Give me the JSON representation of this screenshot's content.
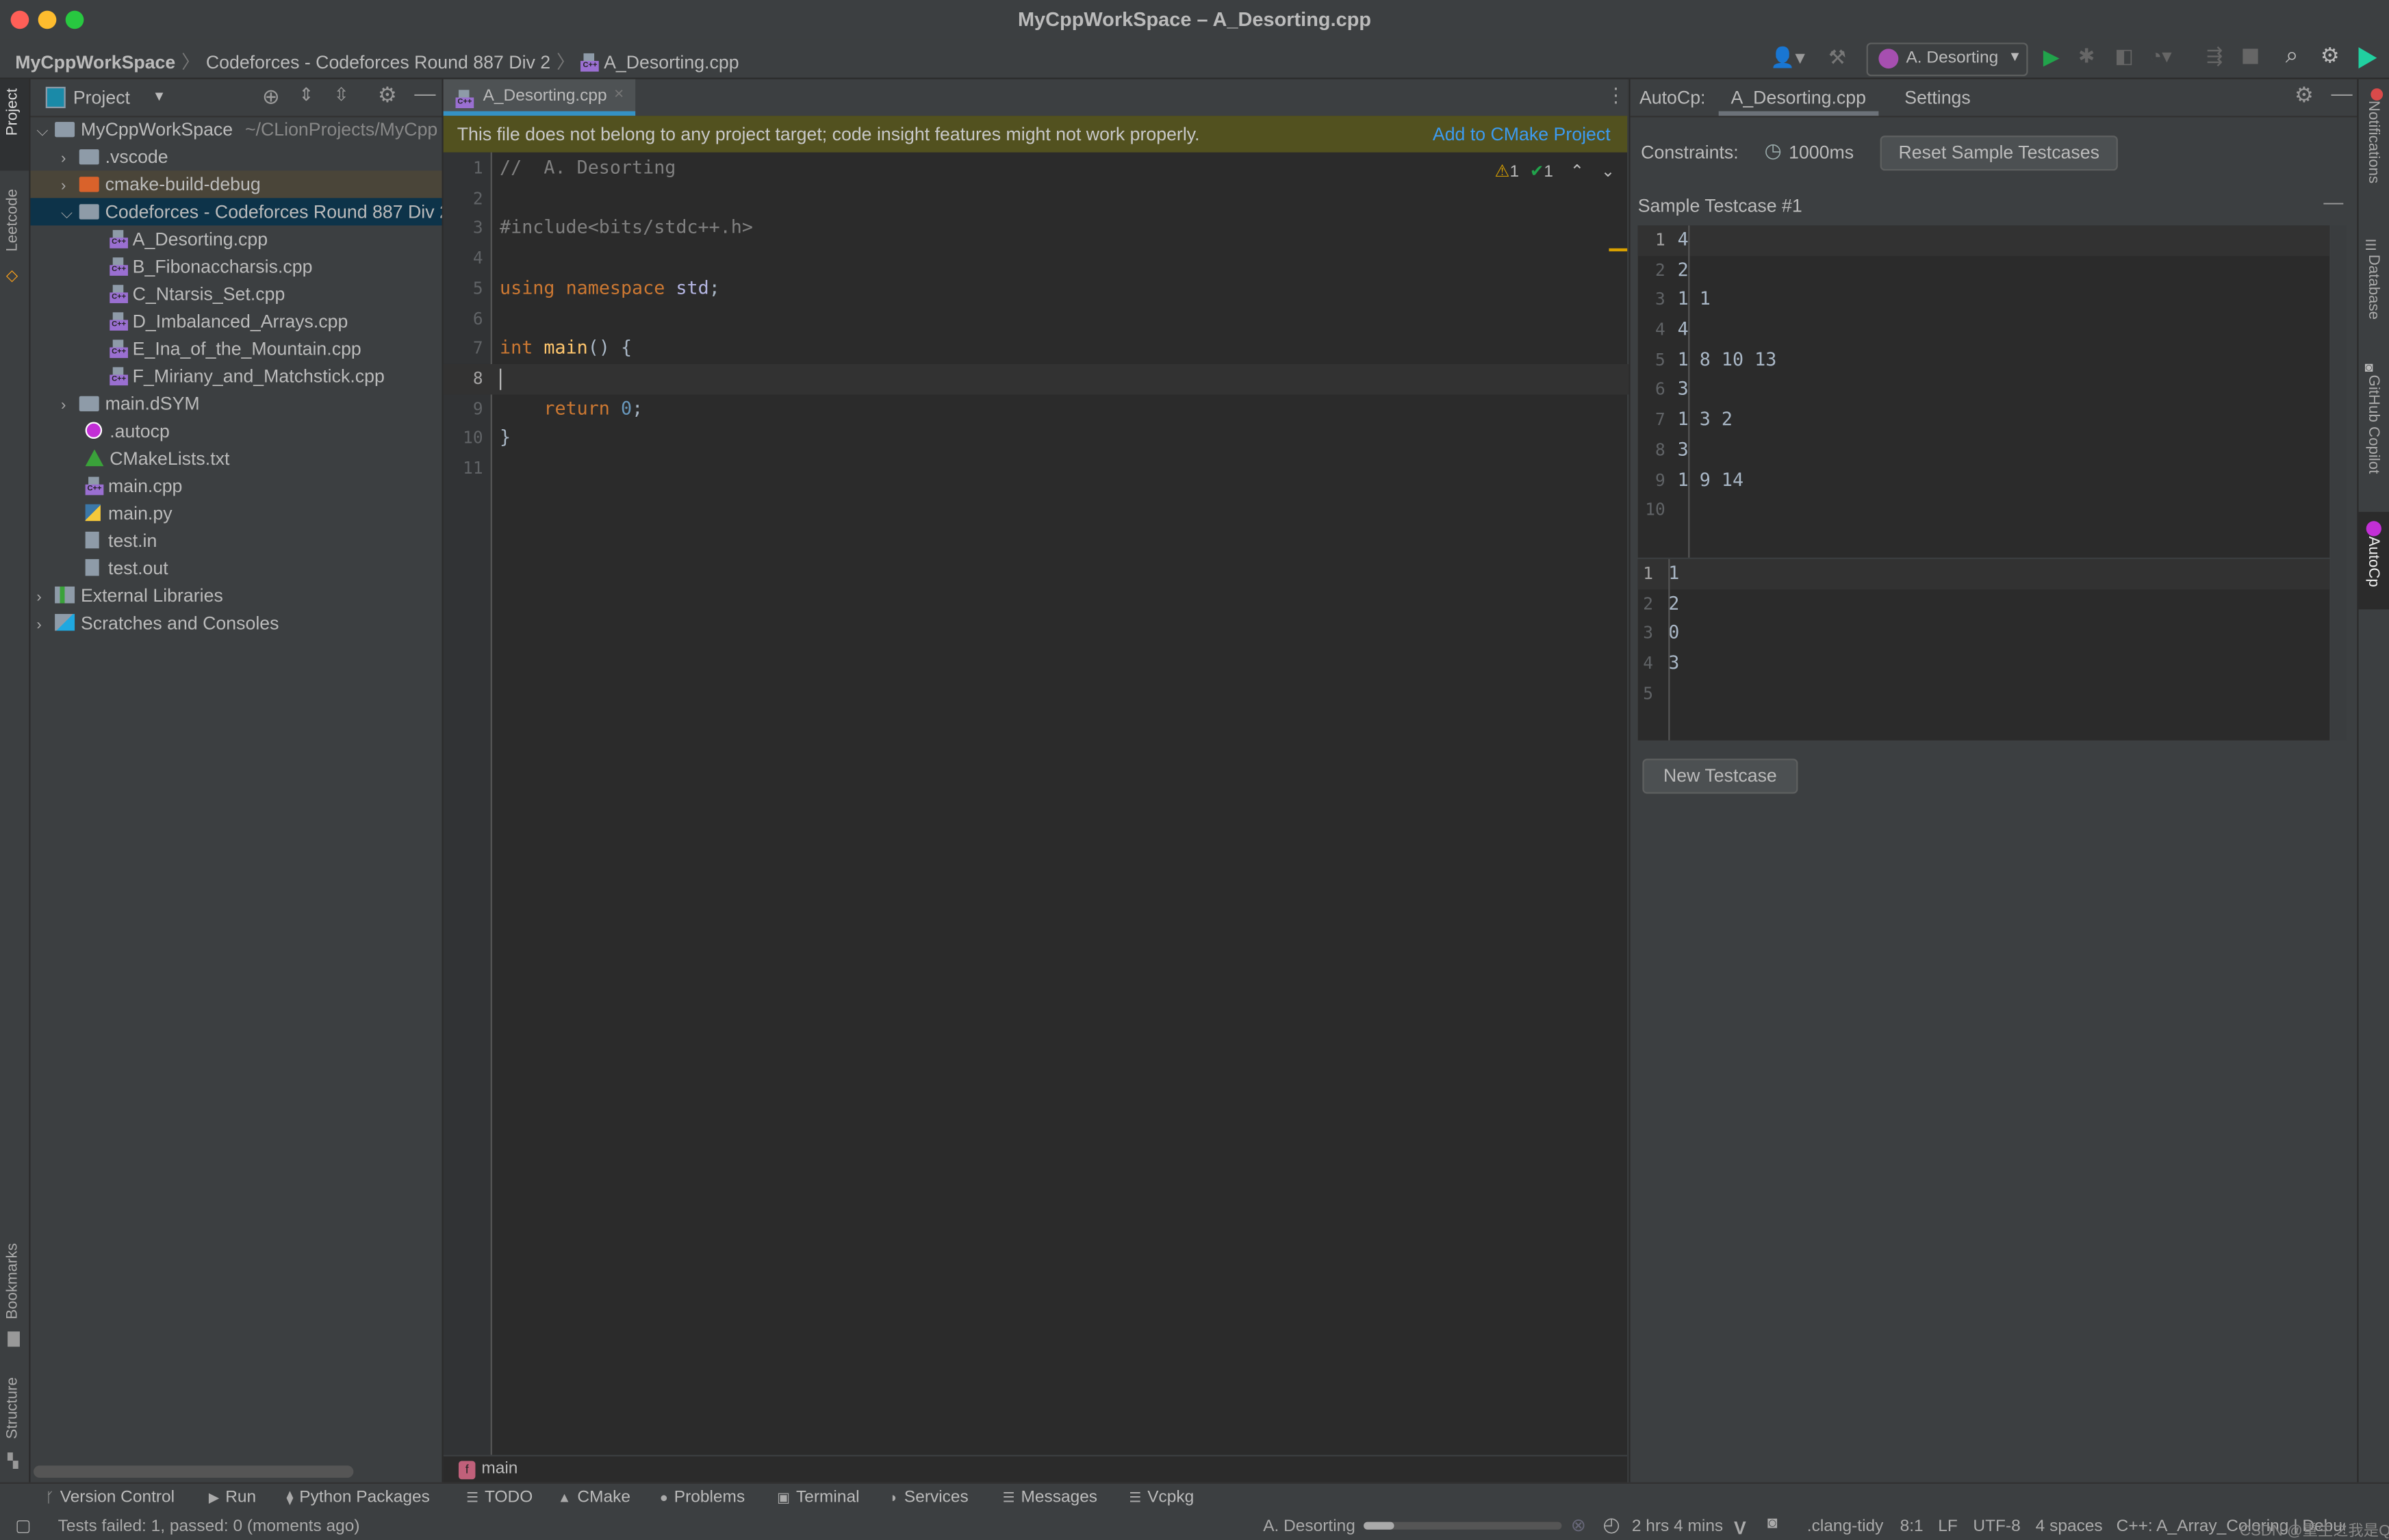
{
  "window": {
    "title": "MyCppWorkSpace – A_Desorting.cpp"
  },
  "breadcrumb": [
    "MyCppWorkSpace",
    "Codeforces - Codeforces Round 887 Div 2",
    "A_Desorting.cpp"
  ],
  "toolbar": {
    "run_config": "A. Desorting"
  },
  "left_stripe": {
    "top": [
      "Project",
      "Leetcode"
    ],
    "bottom": [
      "Bookmarks",
      "Structure"
    ]
  },
  "right_stripe": [
    "Notifications",
    "Database",
    "GitHub Copilot",
    "AutoCp"
  ],
  "project": {
    "header": "Project",
    "root": {
      "name": "MyCppWorkSpace",
      "path": "~/CLionProjects/MyCpp"
    },
    "items": [
      {
        "name": ".vscode",
        "type": "folder",
        "level": 1,
        "expanded": false
      },
      {
        "name": "cmake-build-debug",
        "type": "folder-excluded",
        "level": 1,
        "expanded": false
      },
      {
        "name": "Codeforces - Codeforces Round 887 Div 2",
        "type": "folder",
        "level": 1,
        "expanded": true,
        "selected": true
      },
      {
        "name": "A_Desorting.cpp",
        "type": "cpp",
        "level": 2
      },
      {
        "name": "B_Fibonaccharsis.cpp",
        "type": "cpp",
        "level": 2
      },
      {
        "name": "C_Ntarsis_Set.cpp",
        "type": "cpp",
        "level": 2
      },
      {
        "name": "D_Imbalanced_Arrays.cpp",
        "type": "cpp",
        "level": 2
      },
      {
        "name": "E_Ina_of_the_Mountain.cpp",
        "type": "cpp",
        "level": 2
      },
      {
        "name": "F_Miriany_and_Matchstick.cpp",
        "type": "cpp",
        "level": 2
      },
      {
        "name": "main.dSYM",
        "type": "folder",
        "level": 1,
        "expanded": false
      },
      {
        "name": ".autocp",
        "type": "autocp",
        "level": 1
      },
      {
        "name": "CMakeLists.txt",
        "type": "cmake",
        "level": 1
      },
      {
        "name": "main.cpp",
        "type": "cpp",
        "level": 1
      },
      {
        "name": "main.py",
        "type": "python",
        "level": 1
      },
      {
        "name": "test.in",
        "type": "text",
        "level": 1
      },
      {
        "name": "test.out",
        "type": "text",
        "level": 1
      }
    ],
    "external": "External Libraries",
    "scratches": "Scratches and Consoles"
  },
  "editor": {
    "tab": "A_Desorting.cpp",
    "banner": {
      "message": "This file does not belong to any project target; code insight features might not work properly.",
      "action": "Add to CMake Project"
    },
    "inspections": {
      "warnings": "1",
      "typos": "1"
    },
    "current_line": "8",
    "breadcrumb_fn": "main",
    "lines": [
      "//  A. Desorting",
      "",
      "#include<bits/stdc++.h>",
      "",
      "using namespace std;",
      "",
      "int main() {",
      "",
      "    return 0;",
      "}",
      ""
    ]
  },
  "autocp": {
    "label": "AutoCp:",
    "tabs": [
      "A_Desorting.cpp",
      "Settings"
    ],
    "constraints_label": "Constraints:",
    "time_limit": "1000ms",
    "reset_button": "Reset Sample Testcases",
    "testcase_title": "Sample Testcase #1",
    "input": [
      "4",
      "2",
      "1 1",
      "4",
      "1 8 10 13",
      "3",
      "1 3 2",
      "3",
      "1 9 14",
      ""
    ],
    "output": [
      "1",
      "2",
      "0",
      "3",
      ""
    ],
    "new_button": "New Testcase"
  },
  "tool_windows": [
    "Version Control",
    "Run",
    "Python Packages",
    "TODO",
    "CMake",
    "Problems",
    "Terminal",
    "Services",
    "Messages",
    "Vcpkg"
  ],
  "status": {
    "message": "Tests failed: 1, passed: 0 (moments ago)",
    "task": "A. Desorting",
    "progress": 0.15,
    "time": "2 hrs 4 mins",
    "linter": ".clang-tidy",
    "position": "8:1",
    "line_sep": "LF",
    "encoding": "UTF-8",
    "indent": "4 spaces",
    "context": "C++: A_Array_Coloring | Debug | ok",
    "watermark": "CSDN @重生之我是Q"
  },
  "colors": {
    "accent": "#3592c4",
    "banner": "#52511f",
    "selected": "#0d3349",
    "link": "#3d9bf0",
    "run": "#21a34b"
  }
}
